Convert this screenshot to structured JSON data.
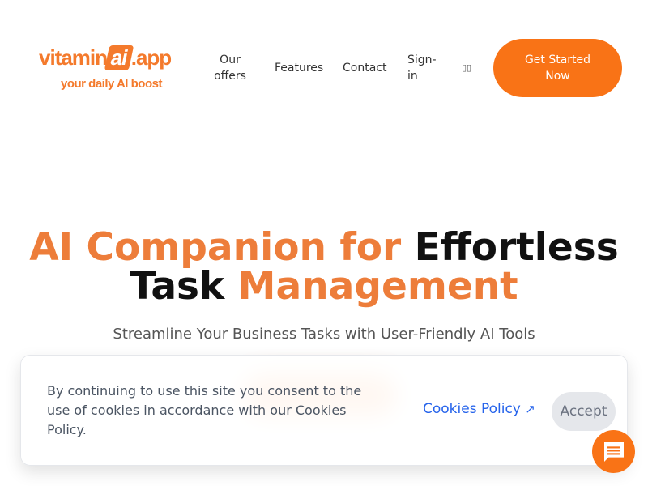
{
  "logo": {
    "text": "vitamin",
    "ai": "ai",
    ".app": ".app",
    "tagline": "your daily AI boost"
  },
  "nav": {
    "items": [
      "Our offers",
      "Features",
      "Contact",
      "Sign-in"
    ],
    "lang": "▯▯",
    "cta": "Get Started Now"
  },
  "hero": {
    "title_orange1": "AI Companion for",
    "title_dark1": "Effortless",
    "title_dark2": "Task",
    "title_orange2": "Management",
    "subtitle": "Streamline Your Business Tasks with User-Friendly AI Tools"
  },
  "cookie": {
    "text": "By continuing to use this site you consent to the use of cookies in accordance with our Cookies Policy.",
    "policy_link": "Cookies Policy",
    "policy_icon": "↗",
    "accept": "Accept"
  },
  "colors": {
    "brand": "#f97316",
    "link": "#2563eb"
  }
}
